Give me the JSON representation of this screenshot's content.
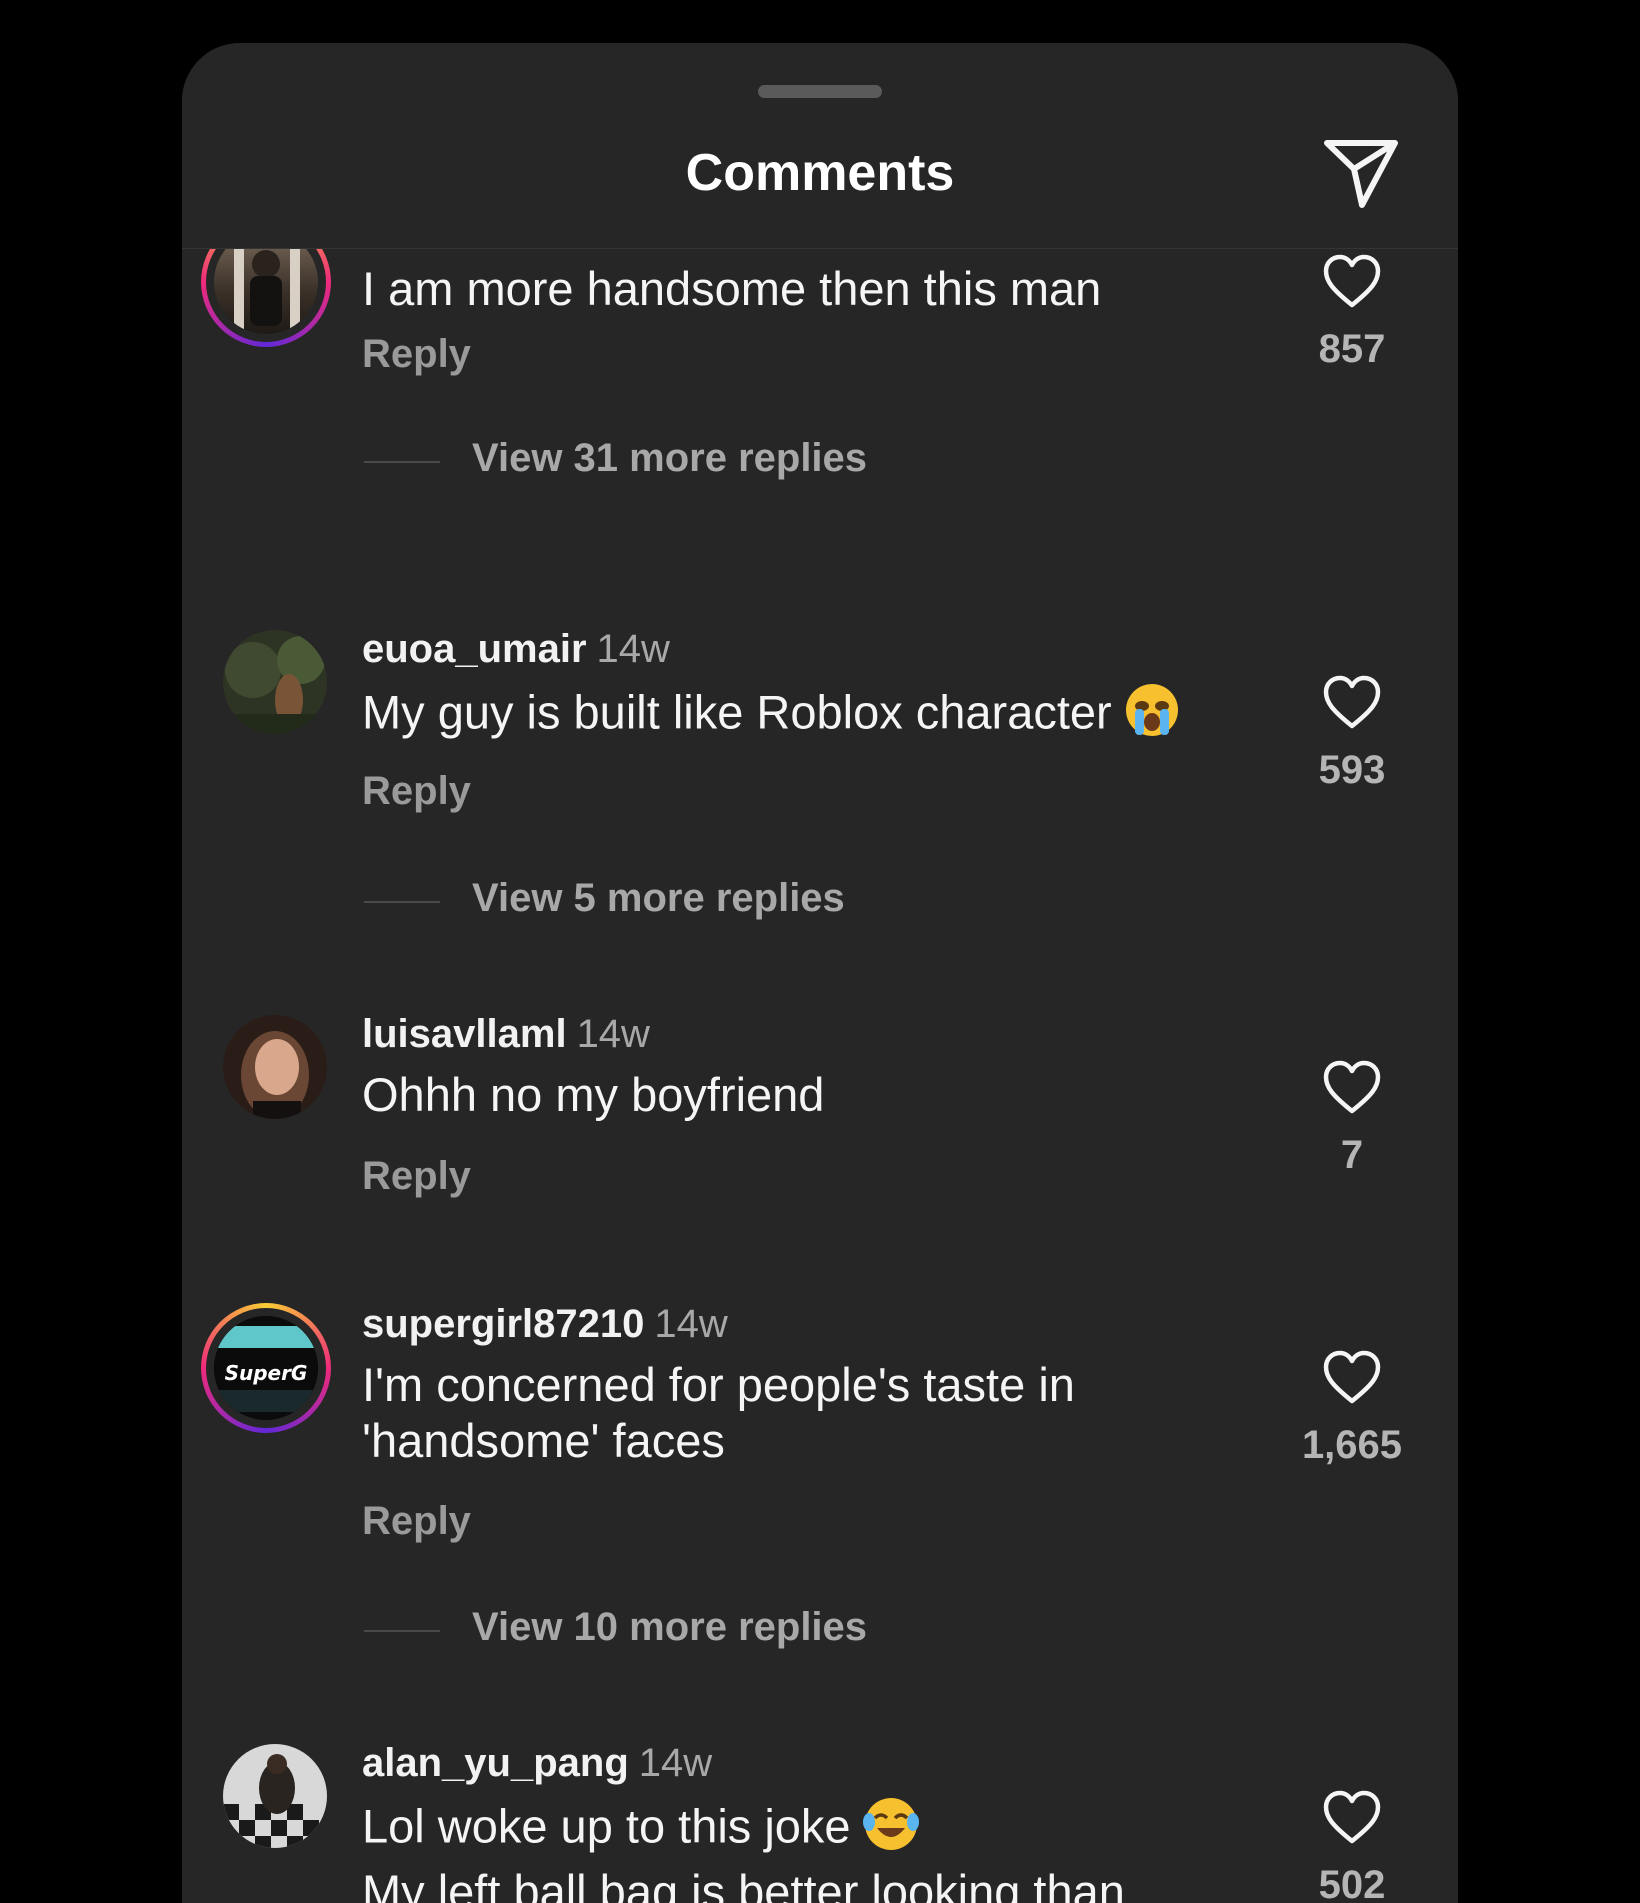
{
  "header": {
    "title": "Comments",
    "send_icon": "send-icon"
  },
  "comments": [
    {
      "username": "",
      "time": "",
      "text": "I am more handsome then this man",
      "reply": "Reply",
      "likes": "857",
      "more_replies": "View 31 more replies",
      "avatar_ring": true
    },
    {
      "username": "euoa_umair",
      "time": "14w",
      "text": "My guy is built like Roblox character",
      "emoji": "loudly-crying-face",
      "reply": "Reply",
      "likes": "593",
      "more_replies": "View 5 more replies",
      "avatar_ring": false
    },
    {
      "username": "luisavllaml",
      "time": "14w",
      "text": "Ohhh no my boyfriend",
      "reply": "Reply",
      "likes": "7",
      "more_replies": "",
      "avatar_ring": false
    },
    {
      "username": "supergirl87210",
      "time": "14w",
      "text_line1": "I'm concerned for people's taste in",
      "text_line2": "'handsome' faces",
      "avatar_text": "SuperG",
      "reply": "Reply",
      "likes": "1,665",
      "more_replies": "View 10 more replies",
      "avatar_ring": true
    },
    {
      "username": "alan_yu_pang",
      "time": "14w",
      "text_line1": "Lol woke up to this joke",
      "emoji": "face-with-tears-of-joy",
      "text_line2": "My left ball bag is better looking than",
      "likes": "502",
      "avatar_ring": false
    }
  ]
}
